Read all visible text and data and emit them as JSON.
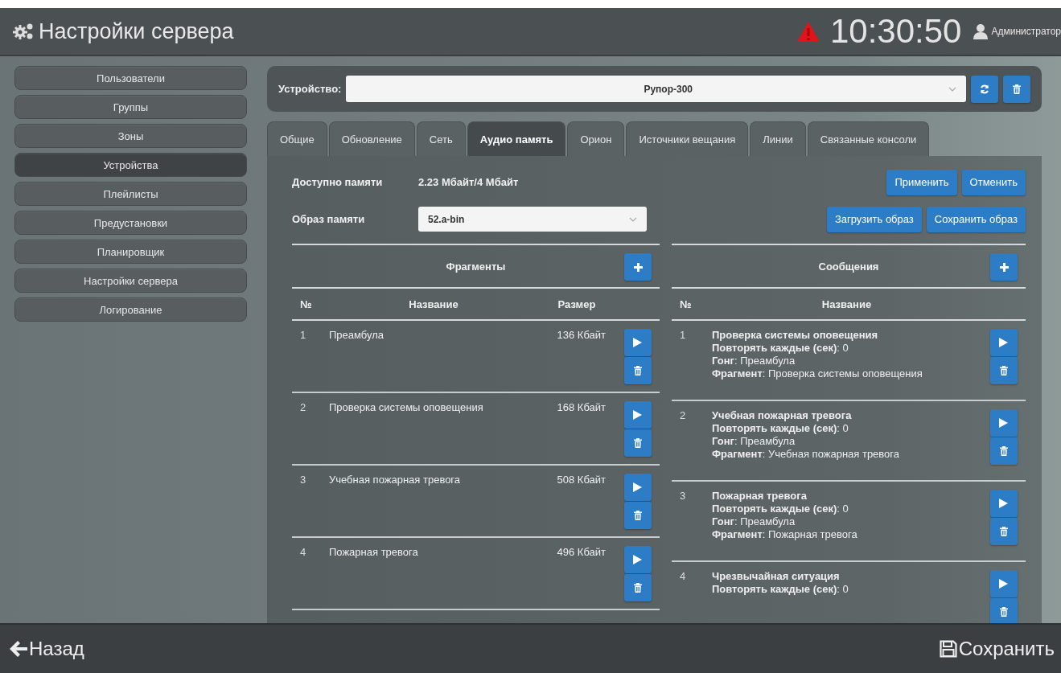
{
  "header": {
    "title": "Настройки сервера",
    "clock": "10:30:50",
    "user": "Администратор"
  },
  "sidebar": {
    "items": [
      {
        "label": "Пользователи",
        "selected": false
      },
      {
        "label": "Группы",
        "selected": false
      },
      {
        "label": "Зоны",
        "selected": false
      },
      {
        "label": "Устройства",
        "selected": true
      },
      {
        "label": "Плейлисты",
        "selected": false
      },
      {
        "label": "Предустановки",
        "selected": false
      },
      {
        "label": "Планировщик",
        "selected": false
      },
      {
        "label": "Настройки сервера",
        "selected": false
      },
      {
        "label": "Логирование",
        "selected": false
      }
    ]
  },
  "device": {
    "label": "Устройство:",
    "value": "Рупор-300"
  },
  "tabs": [
    {
      "label": "Общие",
      "selected": false
    },
    {
      "label": "Обновление",
      "selected": false
    },
    {
      "label": "Сеть",
      "selected": false
    },
    {
      "label": "Аудио память",
      "selected": true
    },
    {
      "label": "Орион",
      "selected": false
    },
    {
      "label": "Источники вещания",
      "selected": false
    },
    {
      "label": "Линии",
      "selected": false
    },
    {
      "label": "Связанные консоли",
      "selected": false
    }
  ],
  "memory": {
    "available_label": "Доступно памяти",
    "available_value": "2.23 Мбайт/4 Мбайт",
    "image_label": "Образ памяти",
    "image_value": "52.a-bin",
    "top_buttons": [
      "Применить",
      "Отменить"
    ],
    "image_buttons": [
      "Загрузить образ",
      "Сохранить образ"
    ]
  },
  "fragments": {
    "title": "Фрагменты",
    "columns": [
      "№",
      "Название",
      "Размер"
    ],
    "rows": [
      {
        "number": "1",
        "name": "Преамбула",
        "size": "136 Кбайт"
      },
      {
        "number": "2",
        "name": "Проверка системы оповещения",
        "size": "168 Кбайт"
      },
      {
        "number": "3",
        "name": "Учебная пожарная тревога",
        "size": "508 Кбайт"
      },
      {
        "number": "4",
        "name": "Пожарная тревога",
        "size": "496 Кбайт"
      }
    ]
  },
  "messages": {
    "title": "Сообщения",
    "columns": [
      "№",
      "Название"
    ],
    "rows": [
      {
        "number": "1",
        "title": "Проверка системы оповещения",
        "details": [
          "**Повторять каждые (сек)**: 0",
          "**Гонг**: Преамбула",
          "**Фрагмент**: Проверка системы оповещения"
        ]
      },
      {
        "number": "2",
        "title": "Учебная пожарная тревога",
        "details": [
          "**Повторять каждые (сек)**: 0",
          "**Гонг**: Преамбула",
          "**Фрагмент**: Учебная пожарная тревога"
        ]
      },
      {
        "number": "3",
        "title": "Пожарная тревога",
        "details": [
          "**Повторять каждые (сек)**: 0",
          "**Гонг**: Преамбула",
          "**Фрагмент**: Пожарная тревога"
        ]
      },
      {
        "number": "4",
        "title": "Чрезвычайная ситуация",
        "details": [
          "**Повторять каждые (сек)**: 0"
        ]
      }
    ]
  },
  "footer": {
    "back": "Назад",
    "save": "Сохранить"
  }
}
